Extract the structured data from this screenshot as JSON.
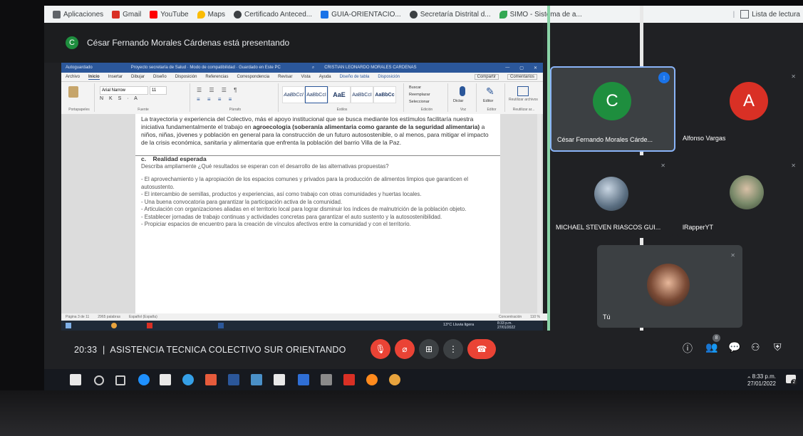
{
  "bookmarks": [
    {
      "label": "Aplicaciones",
      "color": "#5f6368"
    },
    {
      "label": "Gmail",
      "color": "#d93025"
    },
    {
      "label": "YouTube",
      "color": "#ff0000"
    },
    {
      "label": "Maps",
      "color": "#1a73e8"
    },
    {
      "label": "Certificado Anteced...",
      "color": "#3c4043"
    },
    {
      "label": "GUIA-ORIENTACIO...",
      "color": "#1a73e8"
    },
    {
      "label": "Secretaría Distrital d...",
      "color": "#3c4043"
    },
    {
      "label": "SIMO - Sistema de a...",
      "color": "#34a853"
    }
  ],
  "bookmarks_right": "Lista de lectura",
  "presenting": {
    "initial": "C",
    "text": "César Fernando Morales Cárdenas está presentando"
  },
  "word": {
    "title_left": "Autoguardado",
    "title_doc": "Proyecto secretaría de Salud · Modo de compatibilidad · Guardado en Este PC",
    "title_user": "CRISTIAN LEONARDO MORALES CARDENAS",
    "menu": [
      "Archivo",
      "Inicio",
      "Insertar",
      "Dibujar",
      "Diseño",
      "Disposición",
      "Referencias",
      "Correspondencia",
      "Revisar",
      "Vista",
      "Ayuda",
      "Diseño de tabla",
      "Disposición"
    ],
    "share": "Compartir",
    "comments": "Comentarios",
    "font_name": "Arial Narrow",
    "font_size": "11",
    "styles": [
      "AaBbCcI",
      "AaBbCcI",
      "AaE",
      "AaBbCcI",
      "AaBbCc"
    ],
    "style_names": [
      "Énfasis",
      "¶ Normal",
      "Subtítulo",
      "¶ Título",
      "Título 2"
    ],
    "groups": [
      "Portapapeles",
      "Fuente",
      "Párrafo",
      "Estilos",
      "Edición",
      "Voz",
      "Editor",
      "Reutilizar ar..."
    ],
    "editing": [
      "Buscar",
      "Reemplazar",
      "Seleccionar"
    ],
    "dictate": "Dictar",
    "editor": "Editor",
    "reuse": "Reutilizar archivos",
    "doc_intro": "La trayectoria y experiencia del Colectivo, más el apoyo institucional que se busca mediante los estímulos facilitaría nuestra iniciativa fundamentalmente el trabajo en",
    "doc_bold1": "agroecología (soberanía alimentaria como garante de la seguridad alimentaria)",
    "doc_intro2": "a niños, niñas, jóvenes y población en general para la construcción de un futuro autosostenible, o al menos, para mitigar el impacto de la crisis económica, sanitaria y alimentaria que enfrenta la población del barrio Villa de la Paz.",
    "section_letter": "c.",
    "section_title": "Realidad esperada",
    "section_question": "Describa ampliamente ¿Qué resultados se esperan con el desarrollo de las alternativas propuestas?",
    "bullets": [
      "- El aprovechamiento y la apropiación de los espacios comunes y privados para la producción de alimentos limpios que garanticen el autosustento.",
      "- El intercambio de semillas, productos y experiencias, así como trabajo con otras comunidades y huertas locales.",
      "- Una buena convocatoria para garantizar la participación activa de la comunidad.",
      "- Articulación con organizaciones aliadas en el territorio local para lograr disminuir los índices de malnutrición de la población objeto.",
      "- Establecer jornadas de trabajo continuas y actividades concretas para garantizar el auto sustento y la autosostenibilidad.",
      "- Propiciar espacios de encuentro para la creación de vínculos afectivos entre la comunidad y con el territorio."
    ],
    "status_left": "Página 3 de 11",
    "status_words": "2965 palabras",
    "status_lang": "Español (España)",
    "status_focus": "Concentración",
    "status_zoom": "110 %",
    "weather": "13°C Lluvia ligera",
    "inner_clock_time": "8:33 p.m.",
    "inner_clock_date": "27/01/2022"
  },
  "meeting": {
    "time": "20:33",
    "separator": "|",
    "title": "ASISTENCIA TECNICA COLECTIVO SUR ORIENTANDO",
    "participants_badge": "8"
  },
  "controls": {
    "mic_color": "#ea4335",
    "cam_color": "#ea4335",
    "end_color": "#ea4335"
  },
  "participants": [
    {
      "name": "César Fernando Morales Cárde...",
      "initial": "C",
      "color": "#1e8e3e"
    },
    {
      "name": "Alfonso Vargas",
      "initial": "A",
      "color": "#d93025"
    },
    {
      "name": "MICHAEL STEVEN RIASCOS GUI..."
    },
    {
      "name": "lRapperYT"
    },
    {
      "name": "Tú"
    }
  ],
  "taskbar": {
    "time": "8:33 p.m.",
    "date": "27/01/2022",
    "notif": "2"
  }
}
